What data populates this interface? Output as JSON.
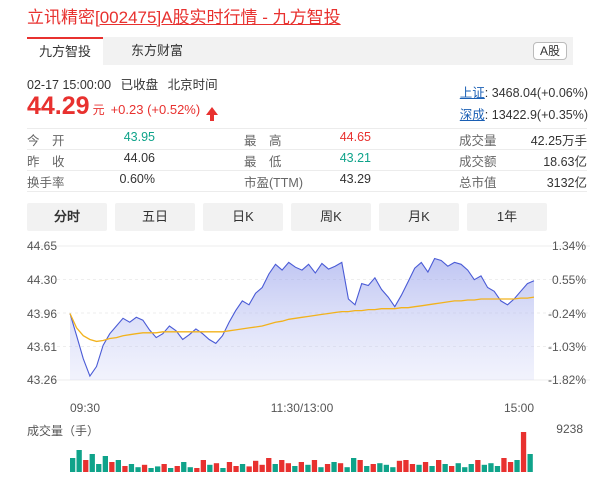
{
  "header": {
    "title_prefix": "立讯精密",
    "title_link": "[002475]A股实时行情 - 九方智投"
  },
  "tabs": [
    {
      "label": "九方智投",
      "active": true
    },
    {
      "label": "东方财富",
      "active": false
    }
  ],
  "market_badge": "A股",
  "quote": {
    "datetime": "02-17 15:00:00",
    "status": "已收盘",
    "timezone": "北京时间",
    "price": "44.29",
    "unit": "元",
    "change": "+0.23 (+0.52%)"
  },
  "indices": [
    {
      "name": "上证",
      "value": ": 3468.04(+0.06%)"
    },
    {
      "name": "深成",
      "value": ": 13422.9(+0.35%)"
    }
  ],
  "stats": [
    {
      "l1": "今　开",
      "v1": "43.95",
      "c1": "green",
      "l2": "最　高",
      "v2": "44.65",
      "c2": "red",
      "l3": "成交量",
      "v3": "42.25万手",
      "c3": ""
    },
    {
      "l1": "昨　收",
      "v1": "44.06",
      "c1": "",
      "l2": "最　低",
      "v2": "43.21",
      "c2": "green",
      "l3": "成交额",
      "v3": "18.63亿",
      "c3": ""
    },
    {
      "l1": "换手率",
      "v1": "0.60%",
      "c1": "",
      "l2": "市盈(TTM)",
      "v2": "43.29",
      "c2": "",
      "l3": "总市值",
      "v3": "3132亿",
      "c3": ""
    }
  ],
  "periods": [
    "分时",
    "五日",
    "日K",
    "周K",
    "月K",
    "1年"
  ],
  "colors": {
    "up": "#e8312f",
    "down": "#0fa38a",
    "price_line": "#4a5bd6",
    "avg_line": "#f2b21c"
  },
  "chart_data": {
    "type": "line",
    "price_axis_labels": [
      "44.65",
      "44.30",
      "43.96",
      "43.61",
      "43.26"
    ],
    "percent_axis_labels": [
      "1.34%",
      "0.55%",
      "-0.24%",
      "-1.03%",
      "-1.82%"
    ],
    "ylim": [
      43.26,
      44.65
    ],
    "x_tick_labels": [
      "09:30",
      "11:30/13:00",
      "15:00"
    ],
    "series": [
      {
        "values": [
          43.95,
          43.72,
          43.48,
          43.3,
          43.4,
          43.62,
          43.74,
          43.82,
          43.9,
          43.86,
          43.91,
          43.88,
          43.78,
          43.7,
          43.74,
          43.82,
          43.77,
          43.68,
          43.73,
          43.79,
          43.74,
          43.68,
          43.64,
          43.72,
          43.86,
          43.98,
          44.08,
          44.04,
          44.16,
          44.22,
          44.36,
          44.46,
          44.4,
          44.48,
          44.43,
          44.4,
          44.46,
          44.37,
          44.47,
          44.41,
          44.44,
          44.48,
          44.1,
          44.04,
          44.26,
          44.24,
          44.32,
          44.2,
          44.12,
          44.02,
          44.14,
          44.28,
          44.42,
          44.48,
          44.38,
          44.52,
          44.5,
          44.44,
          44.48,
          44.46,
          44.4,
          44.3,
          44.34,
          44.22,
          44.18,
          44.08,
          44.04,
          44.1,
          44.18,
          44.26,
          44.29
        ]
      },
      {
        "values": [
          43.95,
          43.8,
          43.72,
          43.68,
          43.66,
          43.67,
          43.69,
          43.7,
          43.72,
          43.73,
          43.74,
          43.75,
          43.75,
          43.75,
          43.76,
          43.76,
          43.76,
          43.76,
          43.76,
          43.76,
          43.76,
          43.76,
          43.76,
          43.76,
          43.77,
          43.78,
          43.79,
          43.8,
          43.81,
          43.82,
          43.84,
          43.86,
          43.87,
          43.89,
          43.9,
          43.91,
          43.92,
          43.93,
          43.94,
          43.95,
          43.96,
          43.97,
          43.97,
          43.98,
          43.98,
          43.99,
          43.99,
          44.0,
          44.0,
          44.0,
          44.01,
          44.01,
          44.02,
          44.03,
          44.04,
          44.05,
          44.06,
          44.07,
          44.08,
          44.08,
          44.09,
          44.09,
          44.1,
          44.1,
          44.1,
          44.1,
          44.1,
          44.1,
          44.11,
          44.11,
          44.12
        ]
      }
    ],
    "volume_title": "成交量（手）",
    "volume_max_label": "9238",
    "volume": [
      [
        0.35,
        "down"
      ],
      [
        0.55,
        "down"
      ],
      [
        0.3,
        "up"
      ],
      [
        0.45,
        "down"
      ],
      [
        0.2,
        "down"
      ],
      [
        0.4,
        "down"
      ],
      [
        0.25,
        "up"
      ],
      [
        0.3,
        "down"
      ],
      [
        0.15,
        "up"
      ],
      [
        0.2,
        "down"
      ],
      [
        0.12,
        "down"
      ],
      [
        0.18,
        "up"
      ],
      [
        0.1,
        "down"
      ],
      [
        0.14,
        "down"
      ],
      [
        0.2,
        "up"
      ],
      [
        0.1,
        "down"
      ],
      [
        0.15,
        "up"
      ],
      [
        0.25,
        "down"
      ],
      [
        0.12,
        "down"
      ],
      [
        0.1,
        "up"
      ],
      [
        0.3,
        "up"
      ],
      [
        0.18,
        "down"
      ],
      [
        0.22,
        "up"
      ],
      [
        0.1,
        "down"
      ],
      [
        0.25,
        "up"
      ],
      [
        0.15,
        "up"
      ],
      [
        0.2,
        "down"
      ],
      [
        0.14,
        "up"
      ],
      [
        0.28,
        "up"
      ],
      [
        0.18,
        "up"
      ],
      [
        0.35,
        "up"
      ],
      [
        0.2,
        "down"
      ],
      [
        0.3,
        "up"
      ],
      [
        0.22,
        "up"
      ],
      [
        0.15,
        "down"
      ],
      [
        0.25,
        "up"
      ],
      [
        0.18,
        "down"
      ],
      [
        0.3,
        "up"
      ],
      [
        0.12,
        "down"
      ],
      [
        0.2,
        "up"
      ],
      [
        0.25,
        "down"
      ],
      [
        0.22,
        "up"
      ],
      [
        0.12,
        "down"
      ],
      [
        0.35,
        "down"
      ],
      [
        0.3,
        "up"
      ],
      [
        0.15,
        "down"
      ],
      [
        0.2,
        "up"
      ],
      [
        0.22,
        "down"
      ],
      [
        0.18,
        "down"
      ],
      [
        0.12,
        "down"
      ],
      [
        0.28,
        "up"
      ],
      [
        0.3,
        "up"
      ],
      [
        0.2,
        "up"
      ],
      [
        0.18,
        "down"
      ],
      [
        0.25,
        "up"
      ],
      [
        0.15,
        "down"
      ],
      [
        0.3,
        "up"
      ],
      [
        0.2,
        "down"
      ],
      [
        0.15,
        "up"
      ],
      [
        0.22,
        "down"
      ],
      [
        0.12,
        "down"
      ],
      [
        0.2,
        "down"
      ],
      [
        0.3,
        "up"
      ],
      [
        0.18,
        "down"
      ],
      [
        0.22,
        "down"
      ],
      [
        0.15,
        "down"
      ],
      [
        0.35,
        "up"
      ],
      [
        0.25,
        "up"
      ],
      [
        0.3,
        "down"
      ],
      [
        1.0,
        "up"
      ],
      [
        0.45,
        "down"
      ]
    ]
  }
}
